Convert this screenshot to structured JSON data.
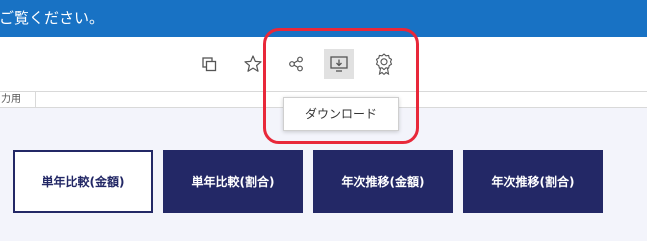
{
  "banner": {
    "text": "ご覧ください。"
  },
  "toolbar": {
    "icons": [
      "copy-icon",
      "star-icon",
      "share-icon",
      "download-icon",
      "badge-icon"
    ]
  },
  "sub_strip": {
    "text": "力用"
  },
  "tooltip": {
    "text": "ダウンロード"
  },
  "nav_buttons": [
    {
      "label": "単年比較(金額)",
      "selected": true
    },
    {
      "label": "単年比較(割合)",
      "selected": false
    },
    {
      "label": "年次推移(金額)",
      "selected": false
    },
    {
      "label": "年次推移(割合)",
      "selected": false
    }
  ],
  "colors": {
    "banner": "#1872c4",
    "highlight": "#e8283a",
    "nav": "#232866",
    "content_bg": "#f3f4fb"
  }
}
